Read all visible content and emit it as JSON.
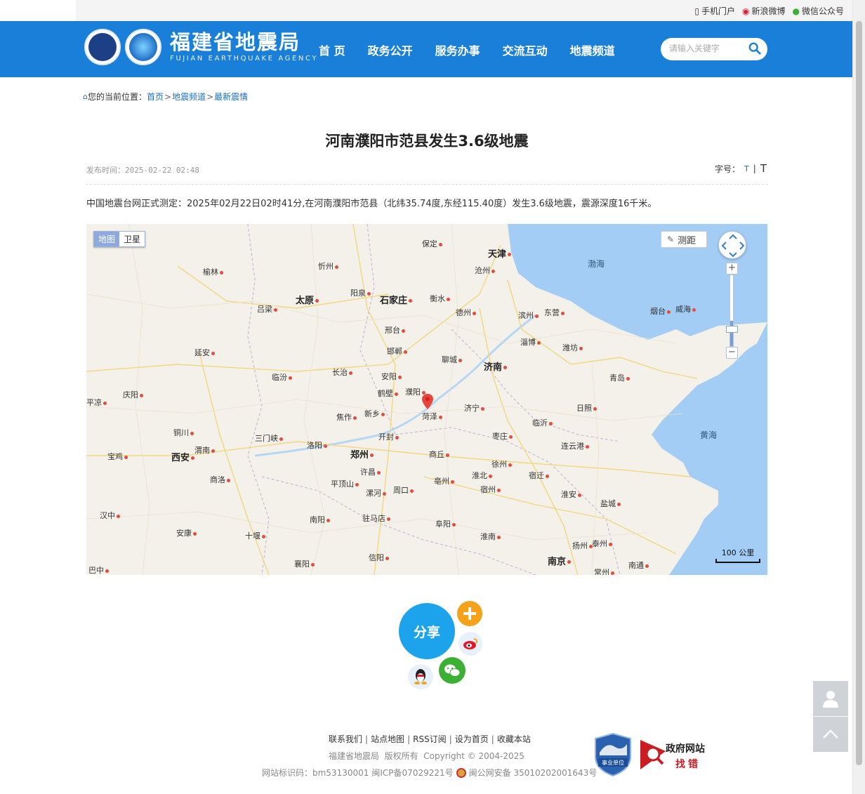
{
  "topbar": {
    "mobile": "手机门户",
    "weibo": "新浪微博",
    "wechat": "微信公众号"
  },
  "header": {
    "logo_cn": "福建省地震局",
    "logo_en": "FUJIAN EARTHQUAKE AGENCY",
    "logo_badge": "FJEA",
    "nav": [
      "首 页",
      "政务公开",
      "服务办事",
      "交流互动",
      "地震频道"
    ],
    "search_placeholder": "请输入关键字"
  },
  "breadcrumb": {
    "prefix": "您的当前位置：",
    "items": [
      "首页",
      "地震频道",
      "最新震情"
    ],
    "sep": ">"
  },
  "article": {
    "title": "河南濮阳市范县发生3.6级地震",
    "publish_label": "发布时间：",
    "publish_time": "2025-02-22 02:48",
    "fontsize_label": "字号：",
    "font_small": "T",
    "font_sep": "|",
    "font_large": "T",
    "body": "中国地震台网正式测定：2025年02月22日02时41分,在河南濮阳市范县（北纬35.74度,东经115.40度）发生3.6级地震，震源深度16千米。"
  },
  "map": {
    "type_map": "地图",
    "type_satellite": "卫星",
    "ranging": "测距",
    "scale": "100 公里",
    "zoom_in": "+",
    "zoom_out": "−",
    "cities": [
      {
        "name": "保定",
        "big": false
      },
      {
        "name": "天津",
        "big": true
      },
      {
        "name": "榆林",
        "big": false
      },
      {
        "name": "忻州",
        "big": false
      },
      {
        "name": "沧州",
        "big": false
      },
      {
        "name": "渤海",
        "sea": true
      },
      {
        "name": "太原",
        "big": true
      },
      {
        "name": "阳泉",
        "big": false
      },
      {
        "name": "石家庄",
        "big": true
      },
      {
        "name": "衡水",
        "big": false
      },
      {
        "name": "吕梁",
        "big": false
      },
      {
        "name": "德州",
        "big": false
      },
      {
        "name": "滨州",
        "big": false
      },
      {
        "name": "东营",
        "big": false
      },
      {
        "name": "烟台",
        "big": false
      },
      {
        "name": "威海",
        "big": false
      },
      {
        "name": "邢台",
        "big": false
      },
      {
        "name": "淄博",
        "big": false
      },
      {
        "name": "潍坊",
        "big": false
      },
      {
        "name": "延安",
        "big": false
      },
      {
        "name": "邯郸",
        "big": false
      },
      {
        "name": "聊城",
        "big": false
      },
      {
        "name": "济南",
        "big": true
      },
      {
        "name": "临汾",
        "big": false
      },
      {
        "name": "长治",
        "big": false
      },
      {
        "name": "安阳",
        "big": false
      },
      {
        "name": "青岛",
        "big": false
      },
      {
        "name": "庆阳",
        "big": false
      },
      {
        "name": "鹤壁",
        "big": false
      },
      {
        "name": "濮阳",
        "big": false
      },
      {
        "name": "平凉",
        "big": false
      },
      {
        "name": "新乡",
        "big": false
      },
      {
        "name": "焦作",
        "big": false
      },
      {
        "name": "菏泽",
        "big": false
      },
      {
        "name": "济宁",
        "big": false
      },
      {
        "name": "日照",
        "big": false
      },
      {
        "name": "铜川",
        "big": false
      },
      {
        "name": "三门峡",
        "big": false
      },
      {
        "name": "开封",
        "big": false
      },
      {
        "name": "临沂",
        "big": false
      },
      {
        "name": "黄海",
        "sea": true
      },
      {
        "name": "枣庄",
        "big": false
      },
      {
        "name": "洛阳",
        "big": false
      },
      {
        "name": "渭南",
        "big": false
      },
      {
        "name": "连云港",
        "big": false
      },
      {
        "name": "宝鸡",
        "big": false
      },
      {
        "name": "西安",
        "big": true
      },
      {
        "name": "郑州",
        "big": true
      },
      {
        "name": "商丘",
        "big": false
      },
      {
        "name": "徐州",
        "big": false
      },
      {
        "name": "许昌",
        "big": false
      },
      {
        "name": "宿迁",
        "big": false
      },
      {
        "name": "淮北",
        "big": false
      },
      {
        "name": "商洛",
        "big": false
      },
      {
        "name": "亳州",
        "big": false
      },
      {
        "name": "平顶山",
        "big": false
      },
      {
        "name": "宿州",
        "big": false
      },
      {
        "name": "周口",
        "big": false
      },
      {
        "name": "漯河",
        "big": false
      },
      {
        "name": "淮安",
        "big": false
      },
      {
        "name": "盐城",
        "big": false
      },
      {
        "name": "汉中",
        "big": false
      },
      {
        "name": "驻马店",
        "big": false
      },
      {
        "name": "南阳",
        "big": false
      },
      {
        "name": "阜阳",
        "big": false
      },
      {
        "name": "安康",
        "big": false
      },
      {
        "name": "十堰",
        "big": false
      },
      {
        "name": "淮南",
        "big": false
      },
      {
        "name": "扬州",
        "big": false
      },
      {
        "name": "泰州",
        "big": false
      },
      {
        "name": "巴中",
        "big": false
      },
      {
        "name": "襄阳",
        "big": false
      },
      {
        "name": "信阳",
        "big": false
      },
      {
        "name": "南京",
        "big": true
      },
      {
        "name": "南通",
        "big": false
      },
      {
        "name": "常州",
        "big": false
      }
    ]
  },
  "share": {
    "label": "分享"
  },
  "footer": {
    "links": [
      "联系我们",
      "站点地图",
      "RSS订阅",
      "设为首页",
      "收藏本站"
    ],
    "copyright": "福建省地震局  版权所有  Copyright © 2004-2025",
    "site_id": "网站标识码：bm53130001",
    "icp": "闽ICP备07029221号",
    "police": "闽公网安备 35010202001643号",
    "badge1": "事业单位",
    "badge2_line1": "政府网站",
    "badge2_line2": "找错"
  },
  "colors": {
    "header_bg": "#1a7fd8",
    "link": "#1a6fb8",
    "share_bg": "#1ca3ec",
    "marker": "#e8443a"
  }
}
